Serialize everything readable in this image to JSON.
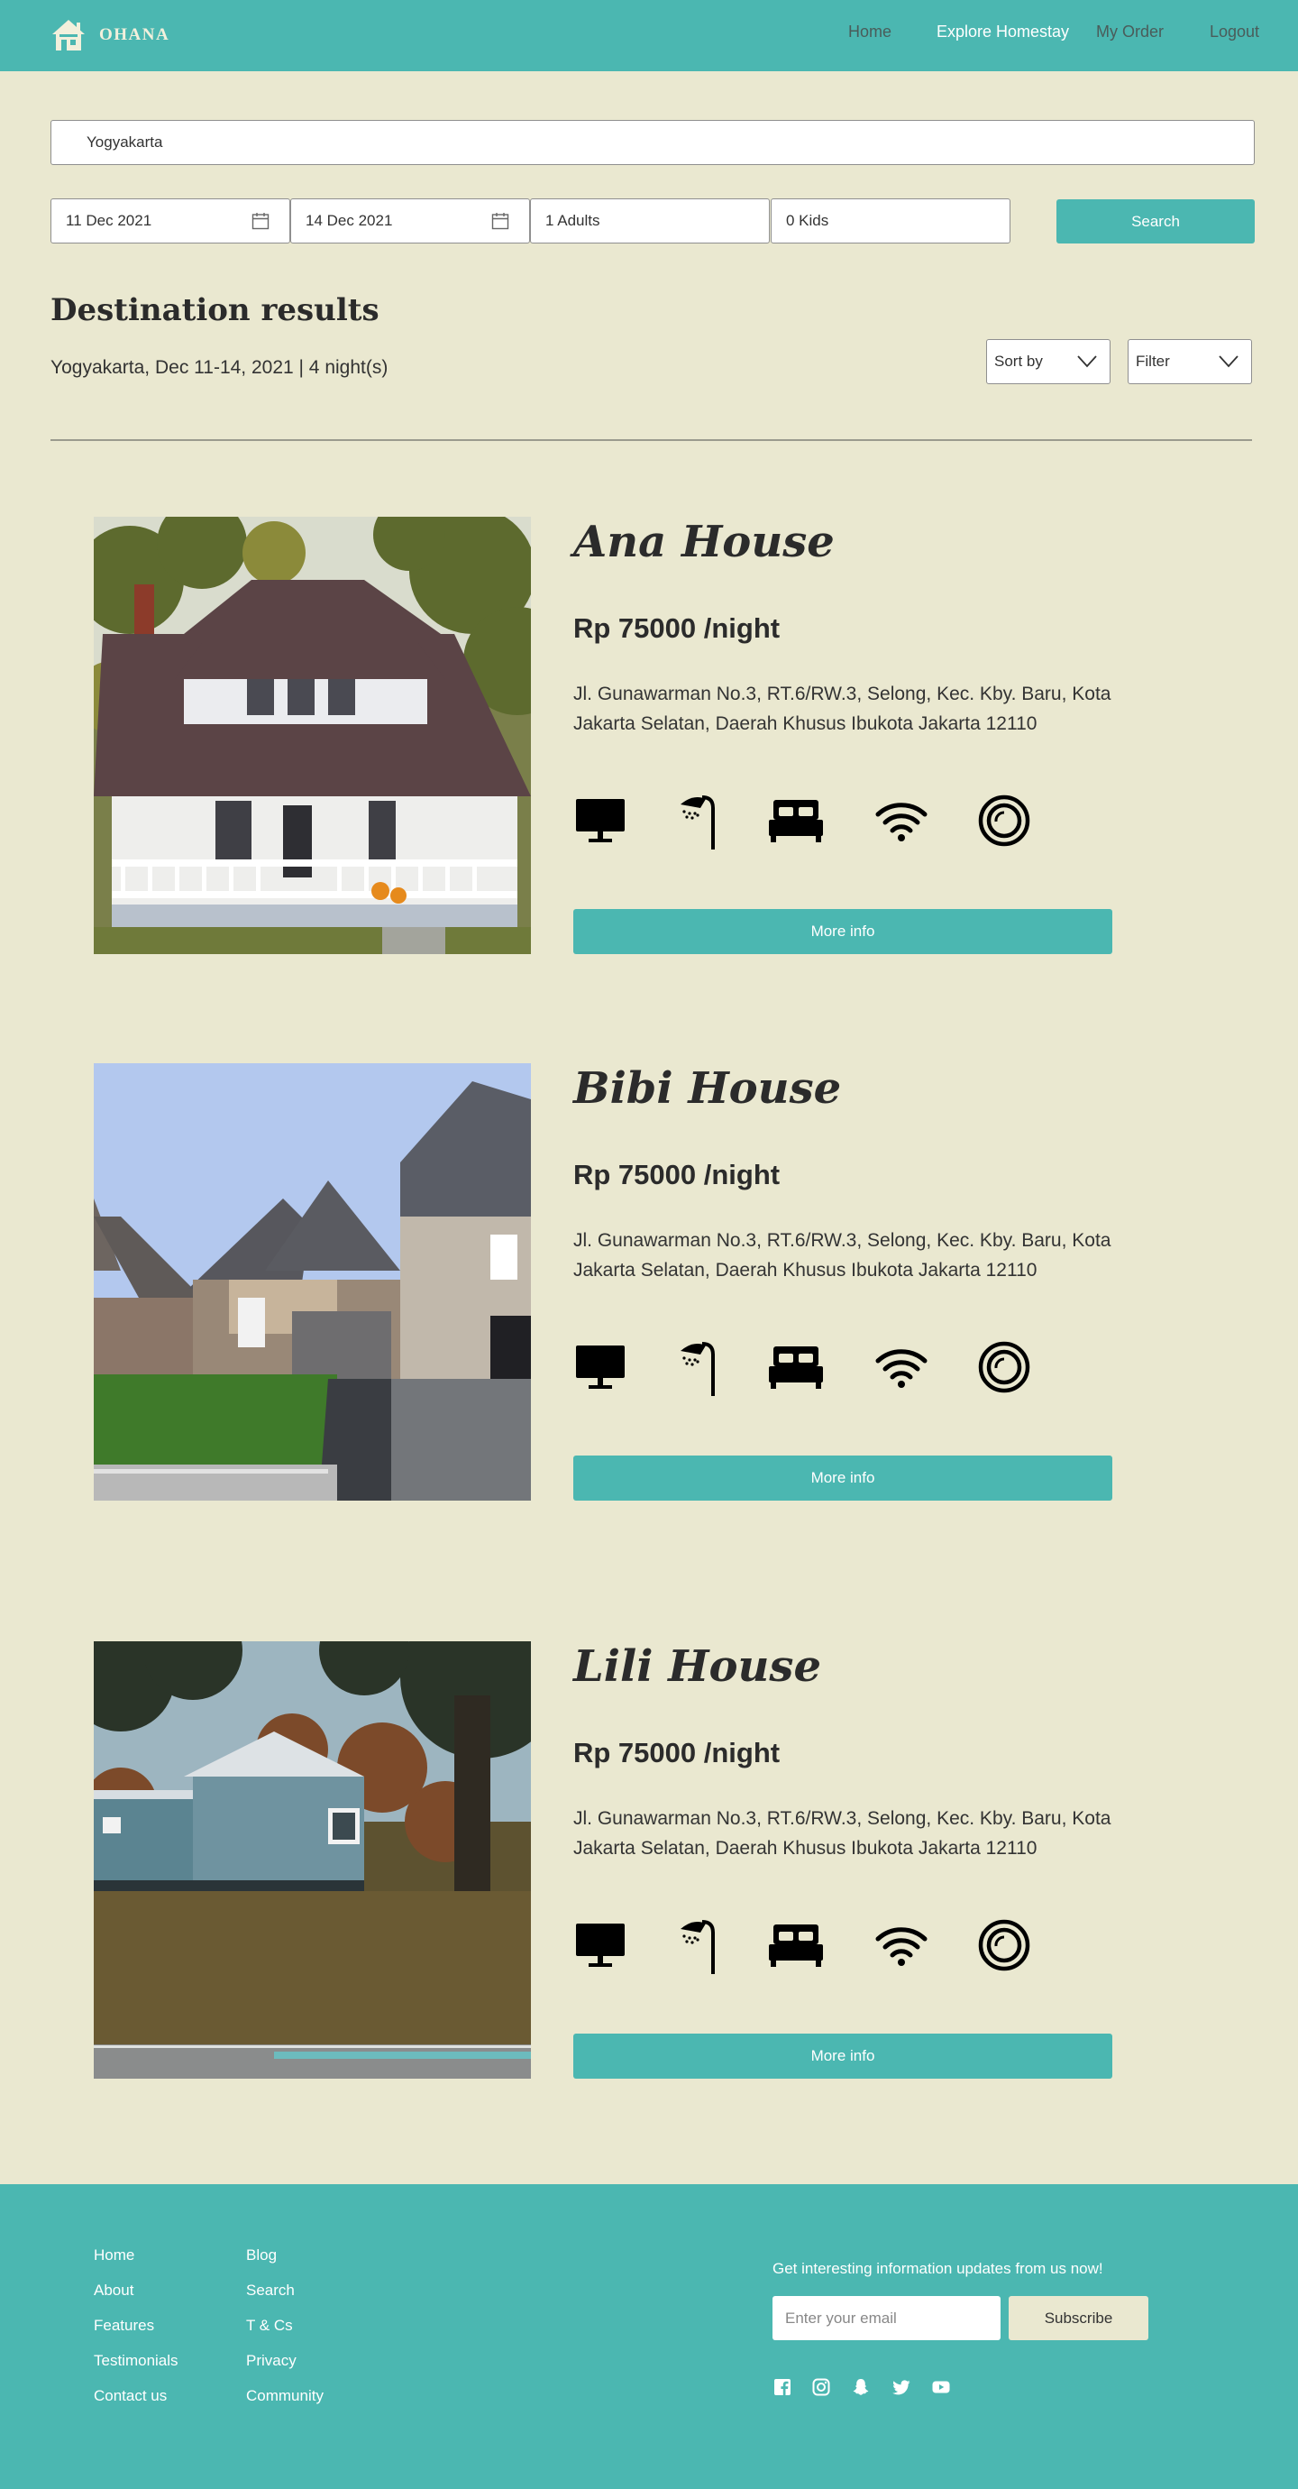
{
  "nav": {
    "brand": "OHANA",
    "links": [
      "Home",
      "Explore Homestay",
      "My Order",
      "Logout"
    ]
  },
  "search": {
    "location": "Yogyakarta",
    "checkin": "11 Dec 2021",
    "checkout": "14 Dec 2021",
    "adults": "1 Adults",
    "kids": "0 Kids",
    "button": "Search"
  },
  "results": {
    "title": "Destination results",
    "subtitle": "Yogyakarta, Dec 11-14, 2021 | 4 night(s)",
    "sort_label": "Sort by",
    "filter_label": "Filter"
  },
  "listings": [
    {
      "name": "Ana House",
      "price": "Rp 75000 /night",
      "address": "Jl. Gunawarman No.3, RT.6/RW.3, Selong, Kec. Kby. Baru, Kota Jakarta Selatan, Daerah Khusus Ibukota Jakarta 12110",
      "button": "More info"
    },
    {
      "name": "Bibi House",
      "price": "Rp 75000 /night",
      "address": "Jl. Gunawarman No.3, RT.6/RW.3, Selong, Kec. Kby. Baru, Kota Jakarta Selatan, Daerah Khusus Ibukota Jakarta 12110",
      "button": "More info"
    },
    {
      "name": "Lili House",
      "price": "Rp 75000 /night",
      "address": "Jl. Gunawarman No.3, RT.6/RW.3, Selong, Kec. Kby. Baru, Kota Jakarta Selatan, Daerah Khusus Ibukota Jakarta 12110",
      "button": "More info"
    }
  ],
  "amenity_icons": [
    "tv-icon",
    "shower-icon",
    "bed-icon",
    "wifi-icon",
    "washing-machine-icon"
  ],
  "footer": {
    "col1": [
      "Home",
      "About",
      "Features",
      "Testimonials",
      "Contact us"
    ],
    "col2": [
      "Blog",
      "Search",
      "T & Cs",
      "Privacy",
      "Community"
    ],
    "newsletter": "Get interesting information updates from us now!",
    "email_placeholder": "Enter your email",
    "subscribe": "Subscribe",
    "social_icons": [
      "facebook-icon",
      "instagram-icon",
      "snapchat-icon",
      "twitter-icon",
      "youtube-icon"
    ]
  },
  "colors": {
    "accent": "#4bb7b1",
    "background": "#eae8d0",
    "text": "#2b2b2b"
  }
}
